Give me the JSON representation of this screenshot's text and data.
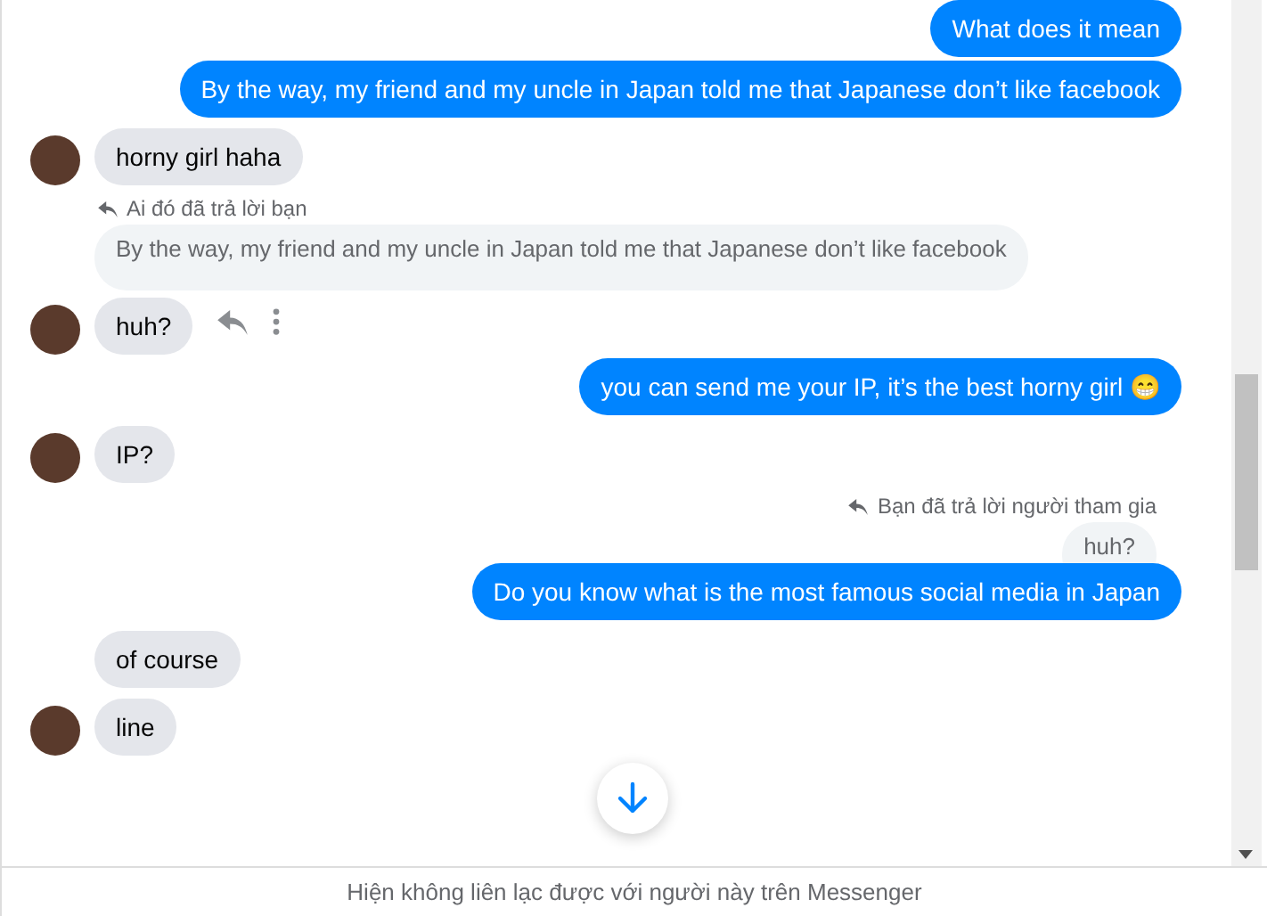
{
  "messages": [
    {
      "kind": "out",
      "text": "What does it mean"
    },
    {
      "kind": "out",
      "text": "By the way, my friend and my uncle in Japan told me that Japanese don’t like facebook"
    },
    {
      "kind": "in",
      "text": "horny girl haha",
      "avatar": true
    },
    {
      "kind": "reply-in",
      "note": "Ai đó đã trả lời bạn",
      "quote": "By the way, my friend and my uncle in Japan told me that Japanese don’t like facebook",
      "text": "huh?",
      "avatar": true
    },
    {
      "kind": "out",
      "text": "you can send me your IP, it’s the best horny girl 😁"
    },
    {
      "kind": "in",
      "text": "IP?",
      "avatar": true
    },
    {
      "kind": "reply-out",
      "note": "Bạn đã trả lời người tham gia",
      "quote": "huh?",
      "text": "Do you know what is the most famous social media in Japan"
    },
    {
      "kind": "in",
      "text": "of course",
      "avatar": false
    },
    {
      "kind": "in",
      "text": "line",
      "avatar": true
    }
  ],
  "footer": "Hiện không liên lạc được với người này trên Messenger"
}
